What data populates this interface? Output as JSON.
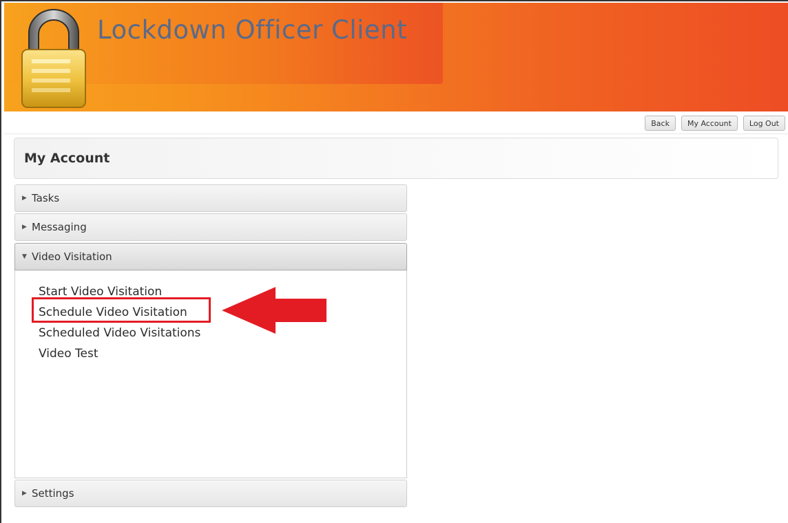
{
  "app": {
    "title": "Lockdown Officer Client"
  },
  "header_actions": {
    "back": "Back",
    "my_account": "My Account",
    "log_out": "Log Out"
  },
  "page": {
    "title": "My Account"
  },
  "accordion": {
    "tasks": "Tasks",
    "messaging": "Messaging",
    "video_visitation": "Video Visitation",
    "settings": "Settings",
    "video_links": [
      "Start Video Visitation",
      "Schedule Video Visitation",
      "Scheduled Video Visitations",
      "Video Test"
    ]
  },
  "colors": {
    "banner_start": "#f7a21e",
    "banner_end": "#ee4d24",
    "highlight": "#e31c24"
  },
  "icons": [
    "lock-logo-icon",
    "caret-right-icon",
    "caret-down-icon",
    "red-arrow-icon"
  ]
}
